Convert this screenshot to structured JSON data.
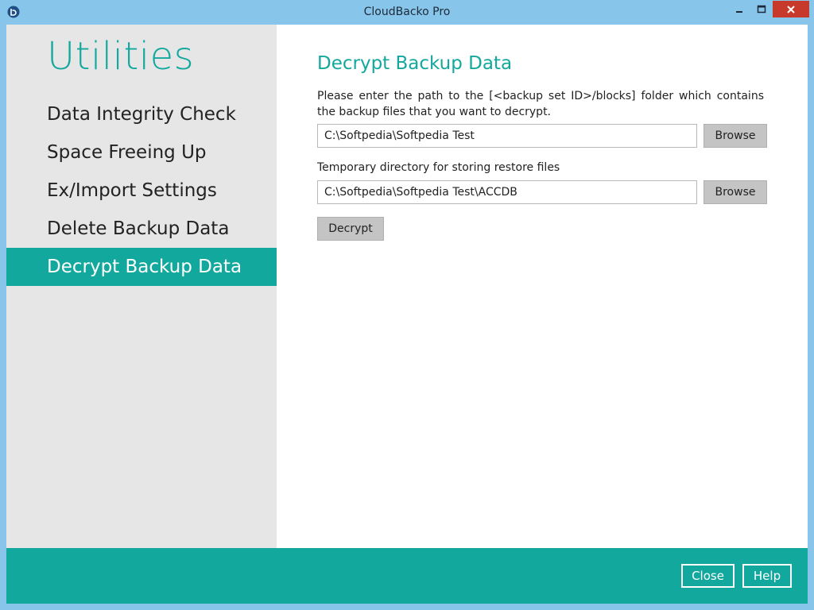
{
  "window": {
    "title": "CloudBacko Pro",
    "icon": "cloudbacko-logo-icon",
    "controls": [
      "minimize-icon",
      "maximize-icon",
      "close-icon"
    ]
  },
  "sidebar": {
    "title": "Utilities",
    "items": [
      {
        "label": "Data Integrity Check",
        "active": false
      },
      {
        "label": "Space Freeing Up",
        "active": false
      },
      {
        "label": "Ex/Import Settings",
        "active": false
      },
      {
        "label": "Delete Backup Data",
        "active": false
      },
      {
        "label": "Decrypt Backup Data",
        "active": true
      }
    ]
  },
  "main": {
    "title": "Decrypt Backup Data",
    "description": "Please enter the path to the [<backup set ID>/blocks] folder which contains the backup files that you want to decrypt.",
    "path_value": "C:\\Softpedia\\Softpedia Test",
    "browse_label": "Browse",
    "temp_dir_label": "Temporary directory for storing restore files",
    "temp_dir_value": "C:\\Softpedia\\Softpedia Test\\ACCDB",
    "decrypt_label": "Decrypt"
  },
  "footer": {
    "close_label": "Close",
    "help_label": "Help"
  },
  "colors": {
    "accent": "#13a89e",
    "sidebar_bg": "#e6e6e6",
    "titlebar_bg": "#88c5ea",
    "window_close": "#c7392b"
  }
}
